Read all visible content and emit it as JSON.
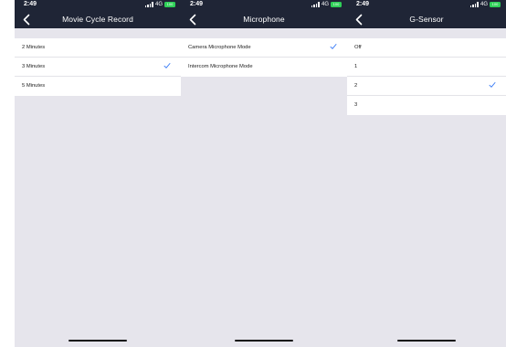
{
  "panels": [
    {
      "time": "2:49",
      "network": "4G",
      "battery": "100",
      "title": "Movie Cycle Record",
      "options": [
        {
          "label": "2 Minutes",
          "selected": false
        },
        {
          "label": "3 Minutes",
          "selected": true
        },
        {
          "label": "5 Minutes",
          "selected": false
        }
      ]
    },
    {
      "time": "2:49",
      "network": "4G",
      "battery": "100",
      "title": "Microphone",
      "options": [
        {
          "label": "Camera Microphone Mode",
          "selected": true
        },
        {
          "label": "Intercom  Microphone Mode",
          "selected": false
        }
      ]
    },
    {
      "time": "2:49",
      "network": "4G",
      "battery": "100",
      "title": "G-Sensor",
      "options": [
        {
          "label": "Off",
          "selected": false
        },
        {
          "label": "1",
          "selected": false
        },
        {
          "label": "2",
          "selected": true
        },
        {
          "label": "3",
          "selected": false
        }
      ]
    }
  ],
  "icons": {
    "back": "chevron-left-icon",
    "check": "checkmark-icon"
  },
  "colors": {
    "header": "#1f2536",
    "accent": "#3478f6",
    "battery": "#2fd058",
    "background": "#e6e5ec"
  }
}
